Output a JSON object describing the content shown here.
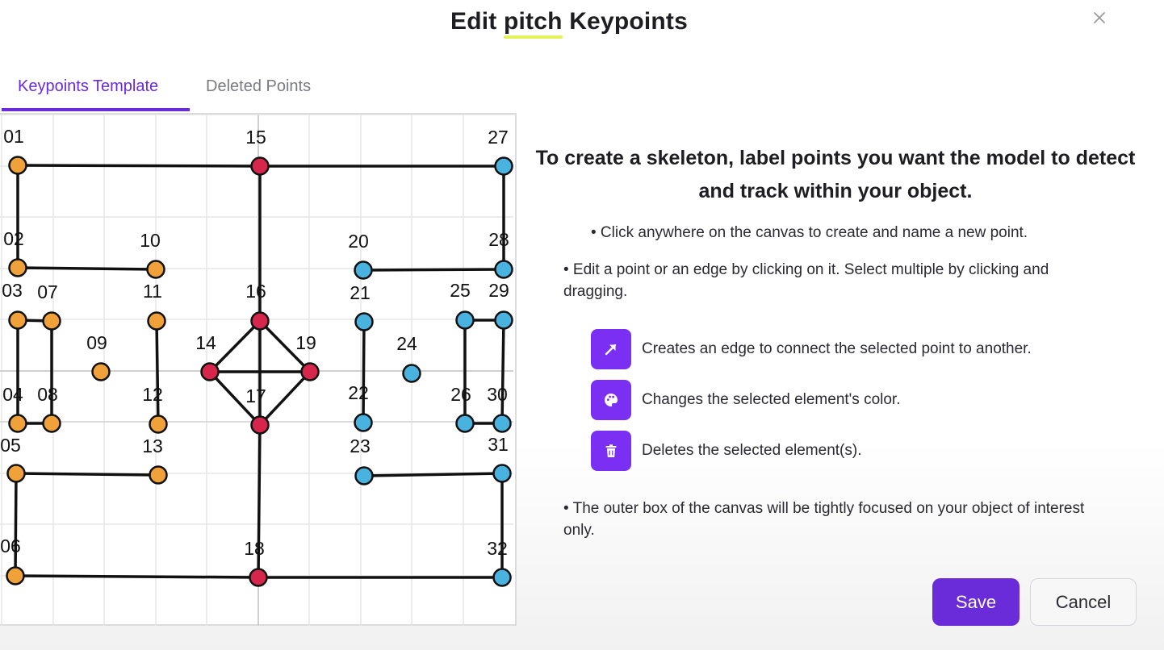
{
  "dialog": {
    "title_pre": "Edit ",
    "title_highlight": "pitch",
    "title_post": " Keypoints",
    "close_icon": "close-icon"
  },
  "tabs": [
    {
      "label": "Keypoints Template",
      "active": true
    },
    {
      "label": "Deleted Points",
      "active": false
    }
  ],
  "colors": {
    "accent": "#6a2bd9",
    "orange": "#f0a139",
    "red": "#d7264b",
    "blue": "#49b2df",
    "highlight": "#e4f25a"
  },
  "skeleton": {
    "points": [
      {
        "label": "01",
        "color": "orange"
      },
      {
        "label": "02",
        "color": "orange"
      },
      {
        "label": "03",
        "color": "orange"
      },
      {
        "label": "04",
        "color": "orange"
      },
      {
        "label": "05",
        "color": "orange"
      },
      {
        "label": "06",
        "color": "orange"
      },
      {
        "label": "07",
        "color": "orange"
      },
      {
        "label": "08",
        "color": "orange"
      },
      {
        "label": "09",
        "color": "orange"
      },
      {
        "label": "10",
        "color": "orange"
      },
      {
        "label": "11",
        "color": "orange"
      },
      {
        "label": "12",
        "color": "orange"
      },
      {
        "label": "13",
        "color": "orange"
      },
      {
        "label": "14",
        "color": "red"
      },
      {
        "label": "15",
        "color": "red"
      },
      {
        "label": "16",
        "color": "red"
      },
      {
        "label": "17",
        "color": "red"
      },
      {
        "label": "18",
        "color": "red"
      },
      {
        "label": "19",
        "color": "red"
      },
      {
        "label": "20",
        "color": "blue"
      },
      {
        "label": "21",
        "color": "blue"
      },
      {
        "label": "22",
        "color": "blue"
      },
      {
        "label": "23",
        "color": "blue"
      },
      {
        "label": "24",
        "color": "blue"
      },
      {
        "label": "25",
        "color": "blue"
      },
      {
        "label": "26",
        "color": "blue"
      },
      {
        "label": "27",
        "color": "blue"
      },
      {
        "label": "28",
        "color": "blue"
      },
      {
        "label": "29",
        "color": "blue"
      },
      {
        "label": "30",
        "color": "blue"
      },
      {
        "label": "31",
        "color": "blue"
      },
      {
        "label": "32",
        "color": "blue"
      }
    ],
    "edges": [
      [
        "01",
        "15"
      ],
      [
        "15",
        "27"
      ],
      [
        "01",
        "02"
      ],
      [
        "27",
        "28"
      ],
      [
        "15",
        "16"
      ],
      [
        "02",
        "10"
      ],
      [
        "20",
        "28"
      ],
      [
        "03",
        "07"
      ],
      [
        "03",
        "04"
      ],
      [
        "07",
        "08"
      ],
      [
        "04",
        "08"
      ],
      [
        "11",
        "12"
      ],
      [
        "16",
        "14"
      ],
      [
        "16",
        "19"
      ],
      [
        "16",
        "17"
      ],
      [
        "14",
        "19"
      ],
      [
        "14",
        "17"
      ],
      [
        "19",
        "17"
      ],
      [
        "17",
        "18"
      ],
      [
        "21",
        "22"
      ],
      [
        "25",
        "29"
      ],
      [
        "25",
        "26"
      ],
      [
        "29",
        "30"
      ],
      [
        "26",
        "30"
      ],
      [
        "05",
        "13"
      ],
      [
        "05",
        "06"
      ],
      [
        "06",
        "18"
      ],
      [
        "18",
        "32"
      ],
      [
        "23",
        "31"
      ],
      [
        "31",
        "32"
      ]
    ]
  },
  "instructions": {
    "heading": "To create a skeleton, label points you want the model to detect and track within your object.",
    "bullet1": "• Click anywhere on the canvas to create and name a new point.",
    "bullet2": "• Edit a point or an edge by clicking on it. Select multiple by clicking and dragging.",
    "bullet3": "• The outer box of the canvas will be tightly focused on your object of interest only."
  },
  "tools": [
    {
      "icon": "arrow-icon",
      "text": "Creates an edge to connect the selected point to another."
    },
    {
      "icon": "palette-icon",
      "text": "Changes the selected element's color."
    },
    {
      "icon": "trash-icon",
      "text": "Deletes the selected element(s)."
    }
  ],
  "buttons": {
    "save": "Save",
    "cancel": "Cancel"
  }
}
